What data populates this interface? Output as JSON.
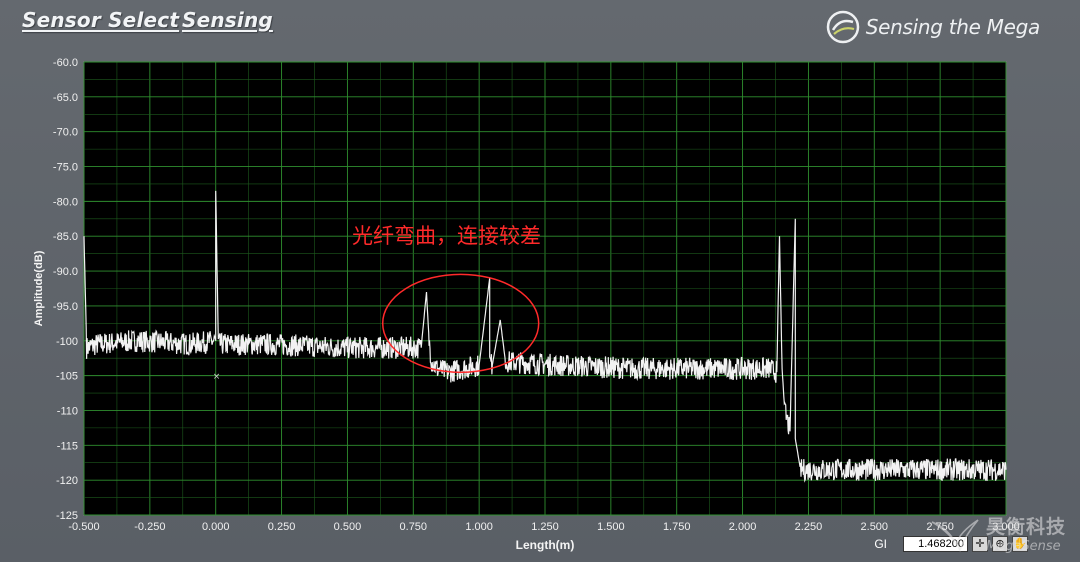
{
  "header": {
    "tabs": [
      {
        "label": "Sensor Select"
      },
      {
        "label": "Sensing"
      }
    ],
    "brand_name": "Sensing the Mega"
  },
  "plot": {
    "annotation": "光纤弯曲，连接较差"
  },
  "gl_control": {
    "label": "GI",
    "value": "1.468200"
  },
  "watermark": {
    "cn": "昊衡科技",
    "en": "MegaSense"
  },
  "chart_data": {
    "type": "line",
    "title": "",
    "xlabel": "Length(m)",
    "ylabel": "Amplitude(dB)",
    "xlim": [
      -0.5,
      3.0
    ],
    "ylim": [
      -125,
      -60
    ],
    "xticks": [
      "-0.500",
      "-0.250",
      "0.000",
      "0.250",
      "0.500",
      "0.750",
      "1.000",
      "1.250",
      "1.500",
      "1.750",
      "2.000",
      "2.250",
      "2.500",
      "2.750",
      "3.000"
    ],
    "yticks": [
      "-60.0",
      "-65.0",
      "-70.0",
      "-75.0",
      "-80.0",
      "-85.0",
      "-90.0",
      "-95.0",
      "-100",
      "-105",
      "-110",
      "-115",
      "-120",
      "-125"
    ],
    "grid": true,
    "colors": {
      "background": "#000000",
      "grid": "#2f8f2f",
      "trace": "#f2f2f2",
      "annotation": "#ff2a2a"
    },
    "series": [
      {
        "x": [
          -0.5,
          -0.49,
          -0.45,
          -0.3,
          -0.1,
          0.0,
          0.0,
          0.01,
          0.2,
          0.5,
          0.7,
          0.78,
          0.8,
          0.81,
          0.82,
          0.84,
          0.88,
          1.0,
          1.04,
          1.04,
          1.05,
          1.08,
          1.1,
          1.3,
          1.6,
          1.9,
          2.1,
          2.13,
          2.14,
          2.15,
          2.16,
          2.18,
          2.2,
          2.2,
          2.22,
          2.4,
          2.7,
          3.0
        ],
        "y": [
          -85,
          -101,
          -100.5,
          -100,
          -100.5,
          -100,
          -78.5,
          -100.5,
          -100.5,
          -101,
          -101,
          -101,
          -93,
          -100,
          -103,
          -104,
          -104.5,
          -103.5,
          -91,
          -103,
          -103.5,
          -97,
          -103,
          -103.5,
          -104,
          -104,
          -104,
          -104.5,
          -85,
          -104,
          -110,
          -113,
          -82.5,
          -114,
          -118.5,
          -118.5,
          -118.5,
          -118.5
        ]
      }
    ],
    "annotations": [
      {
        "text": "光纤弯曲，连接较差",
        "x": 1.0,
        "y": -95
      }
    ]
  }
}
